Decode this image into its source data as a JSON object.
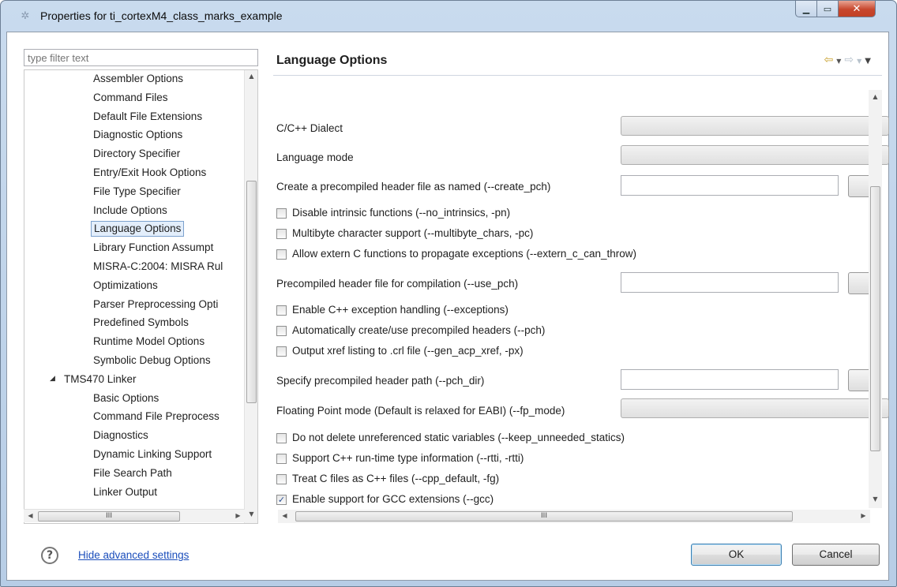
{
  "window": {
    "title": "Properties for ti_cortexM4_class_marks_example"
  },
  "filter": {
    "placeholder": "type filter text"
  },
  "tree": {
    "items": [
      {
        "label": "Assembler Options",
        "level": 2,
        "selected": false
      },
      {
        "label": "Command Files",
        "level": 2,
        "selected": false
      },
      {
        "label": "Default File Extensions",
        "level": 2,
        "selected": false
      },
      {
        "label": "Diagnostic Options",
        "level": 2,
        "selected": false
      },
      {
        "label": "Directory Specifier",
        "level": 2,
        "selected": false
      },
      {
        "label": "Entry/Exit Hook Options",
        "level": 2,
        "selected": false
      },
      {
        "label": "File Type Specifier",
        "level": 2,
        "selected": false
      },
      {
        "label": "Include Options",
        "level": 2,
        "selected": false
      },
      {
        "label": "Language Options",
        "level": 2,
        "selected": true
      },
      {
        "label": "Library Function Assumpt",
        "level": 2,
        "selected": false
      },
      {
        "label": "MISRA-C:2004: MISRA Rul",
        "level": 2,
        "selected": false
      },
      {
        "label": "Optimizations",
        "level": 2,
        "selected": false
      },
      {
        "label": "Parser Preprocessing Opti",
        "level": 2,
        "selected": false
      },
      {
        "label": "Predefined Symbols",
        "level": 2,
        "selected": false
      },
      {
        "label": "Runtime Model Options",
        "level": 2,
        "selected": false
      },
      {
        "label": "Symbolic Debug Options",
        "level": 2,
        "selected": false
      },
      {
        "label": "TMS470 Linker",
        "level": 1,
        "selected": false,
        "expanded": true
      },
      {
        "label": "Basic Options",
        "level": 2,
        "selected": false
      },
      {
        "label": "Command File Preprocess",
        "level": 2,
        "selected": false
      },
      {
        "label": "Diagnostics",
        "level": 2,
        "selected": false
      },
      {
        "label": "Dynamic Linking Support",
        "level": 2,
        "selected": false
      },
      {
        "label": "File Search Path",
        "level": 2,
        "selected": false
      },
      {
        "label": "Linker Output",
        "level": 2,
        "selected": false
      }
    ]
  },
  "panel": {
    "title": "Language Options",
    "dialect_label": "C/C++ Dialect",
    "langmode_label": "Language mode",
    "create_pch_label": "Create a precompiled header file as named (--create_pch)",
    "no_intrinsics_label": "Disable intrinsic functions (--no_intrinsics, -pn)",
    "multibyte_label": "Multibyte character support (--multibyte_chars, -pc)",
    "extern_c_label": "Allow extern C functions to propagate exceptions (--extern_c_can_throw)",
    "use_pch_label": "Precompiled header file for compilation (--use_pch)",
    "exceptions_label": "Enable C++ exception handling (--exceptions)",
    "pch_label": "Automatically create/use precompiled headers (--pch)",
    "xref_label": "Output xref listing to .crl file (--gen_acp_xref, -px)",
    "pch_dir_label": "Specify precompiled header path (--pch_dir)",
    "fp_mode_label": "Floating Point mode (Default is relaxed for EABI) (--fp_mode)",
    "keep_unneeded_label": "Do not delete unreferenced static variables (--keep_unneeded_statics)",
    "rtti_label": "Support C++ run-time type information (--rtti, -rtti)",
    "cpp_default_label": "Treat C files as C++ files (--cpp_default, -fg)",
    "gcc_label": "Enable support for GCC extensions (--gcc)",
    "gcc_checked": true
  },
  "footer": {
    "help_link": "Hide advanced settings",
    "ok_label": "OK",
    "cancel_label": "Cancel"
  }
}
